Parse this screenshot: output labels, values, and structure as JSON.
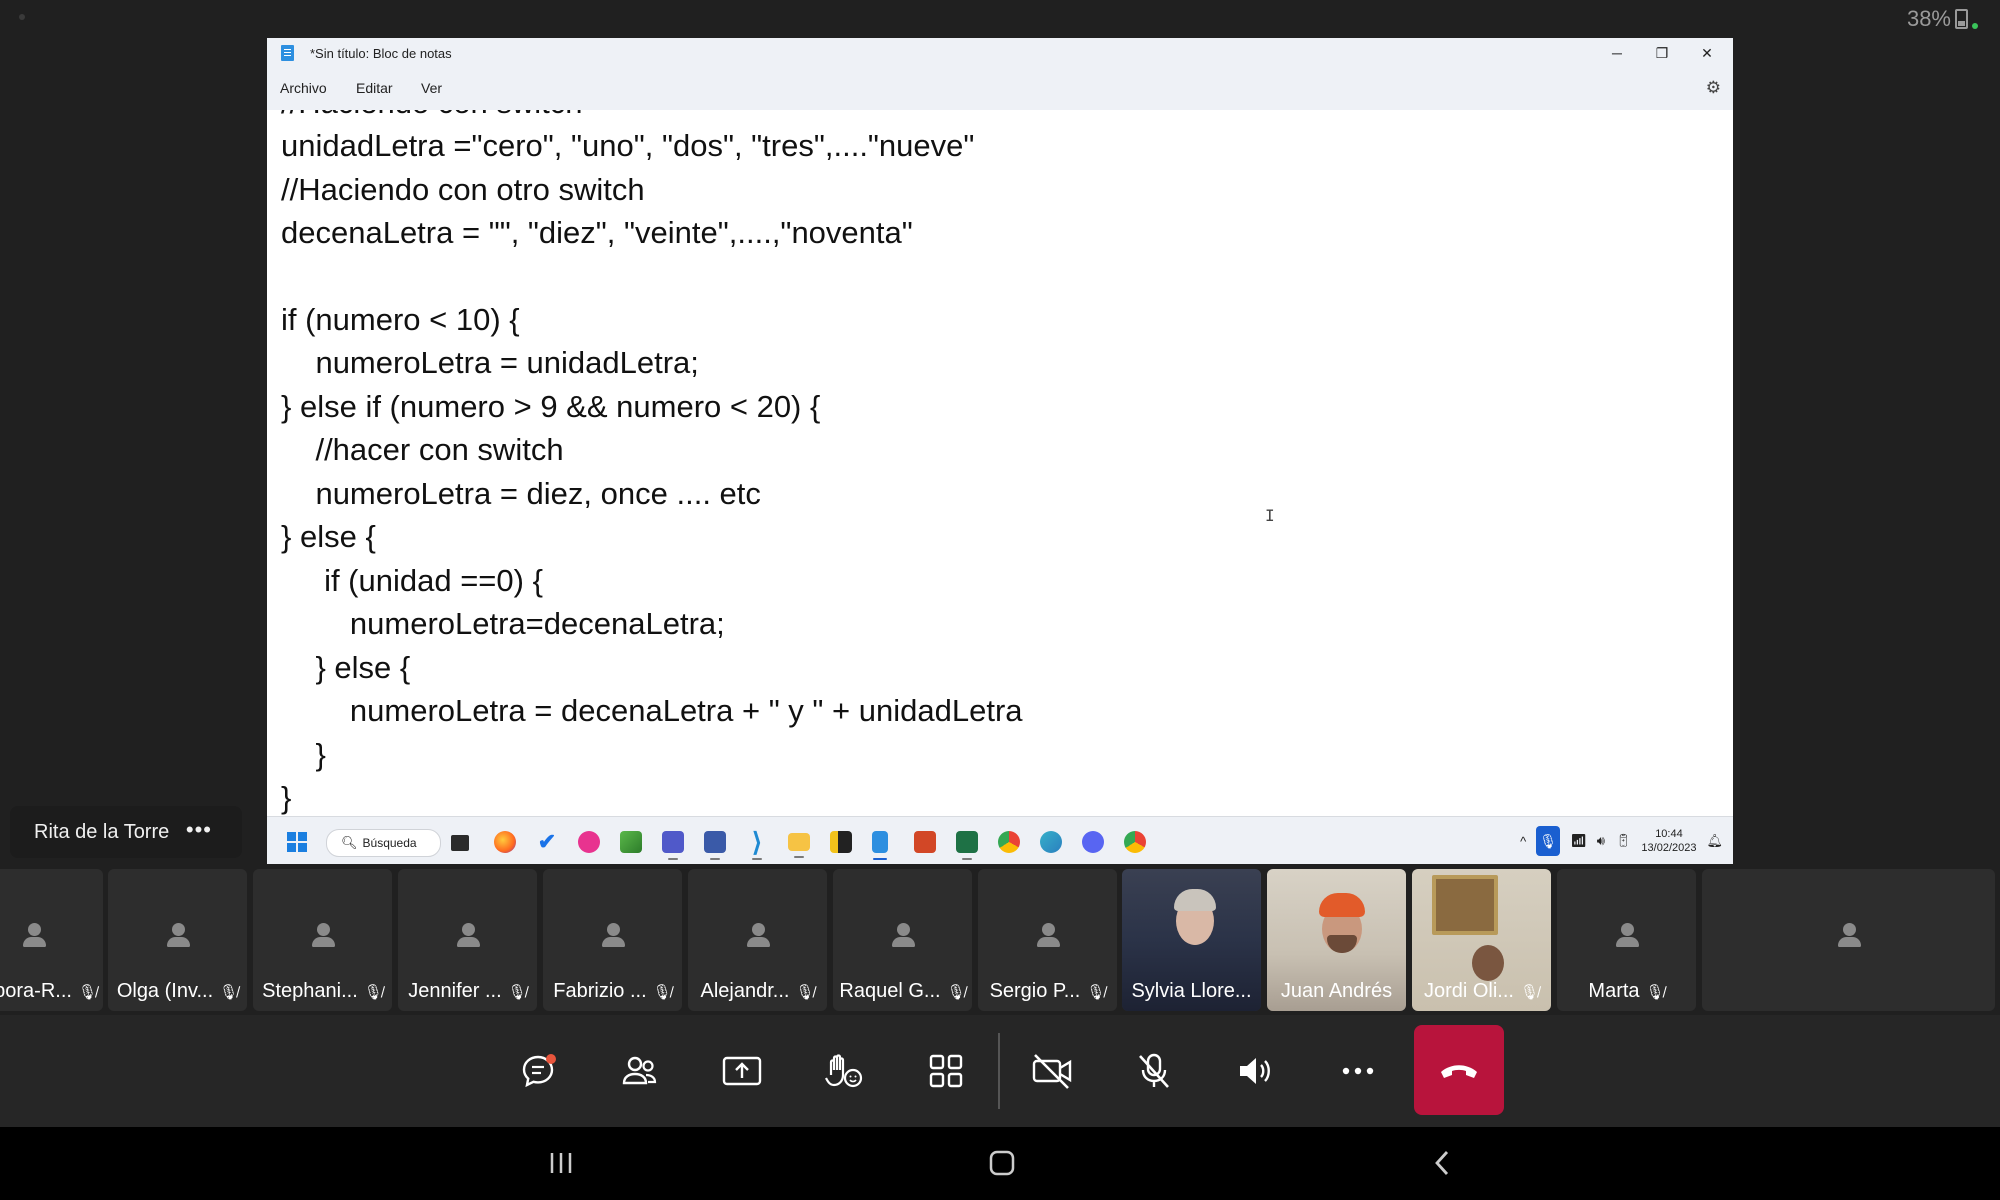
{
  "status": {
    "battery_text": "38%"
  },
  "notepad": {
    "title": "*Sin título: Bloc de notas",
    "menu": [
      "Archivo",
      "Editar",
      "Ver"
    ],
    "lines": [
      "//Haciendo con switch",
      "unidadLetra =\"cero\", \"uno\", \"dos\", \"tres\",....\"nueve\"",
      "//Haciendo con otro switch",
      "decenaLetra = \"\", \"diez\", \"veinte\",....,\"noventa\"",
      "",
      "if (numero < 10) {",
      "    numeroLetra = unidadLetra;",
      "} else if (numero > 9 && numero < 20) {",
      "    //hacer con switch",
      "    numeroLetra = diez, once .... etc",
      "} else {",
      "     if (unidad ==0) {",
      "        numeroLetra=decenaLetra;",
      "    } else {",
      "        numeroLetra = decenaLetra + \" y \" + unidadLetra",
      "    }",
      "}"
    ]
  },
  "taskbar": {
    "search_label": "Búsqueda",
    "time": "10:44",
    "date": "13/02/2023",
    "apps": [
      "file-explorer-dark",
      "firefox",
      "todo",
      "app-pink",
      "paint",
      "teams",
      "outlook-teams",
      "vscode",
      "folder",
      "sticky",
      "notepad",
      "powerpoint",
      "excel",
      "chrome",
      "edge-dev",
      "discord",
      "chrome-alt"
    ]
  },
  "presenter": {
    "name": "Rita de la Torre",
    "more": "•••"
  },
  "participants": [
    {
      "name": "bora-R...",
      "muted": true,
      "video": false
    },
    {
      "name": "Olga (Inv...",
      "muted": true,
      "video": false
    },
    {
      "name": "Stephani...",
      "muted": true,
      "video": false
    },
    {
      "name": "Jennifer ...",
      "muted": true,
      "video": false
    },
    {
      "name": "Fabrizio ...",
      "muted": true,
      "video": false
    },
    {
      "name": "Alejandr...",
      "muted": true,
      "video": false
    },
    {
      "name": "Raquel G...",
      "muted": true,
      "video": false
    },
    {
      "name": "Sergio P...",
      "muted": true,
      "video": false
    },
    {
      "name": "Sylvia Llore...",
      "muted": false,
      "video": true
    },
    {
      "name": "Juan Andrés",
      "muted": false,
      "video": true
    },
    {
      "name": "Jordi Oli...",
      "muted": true,
      "video": true
    },
    {
      "name": "Marta",
      "muted": true,
      "video": false
    },
    {
      "name": "",
      "muted": false,
      "video": false
    }
  ],
  "controls": [
    "chat-icon",
    "people-icon",
    "share-screen-icon",
    "reactions-icon",
    "view-layout-icon",
    "camera-off-icon",
    "mic-off-icon",
    "speaker-icon",
    "more-icon",
    "hang-up-icon"
  ],
  "colors": {
    "hangup": "#b8143c",
    "bg": "#202020",
    "tile": "#2d2d2d"
  }
}
